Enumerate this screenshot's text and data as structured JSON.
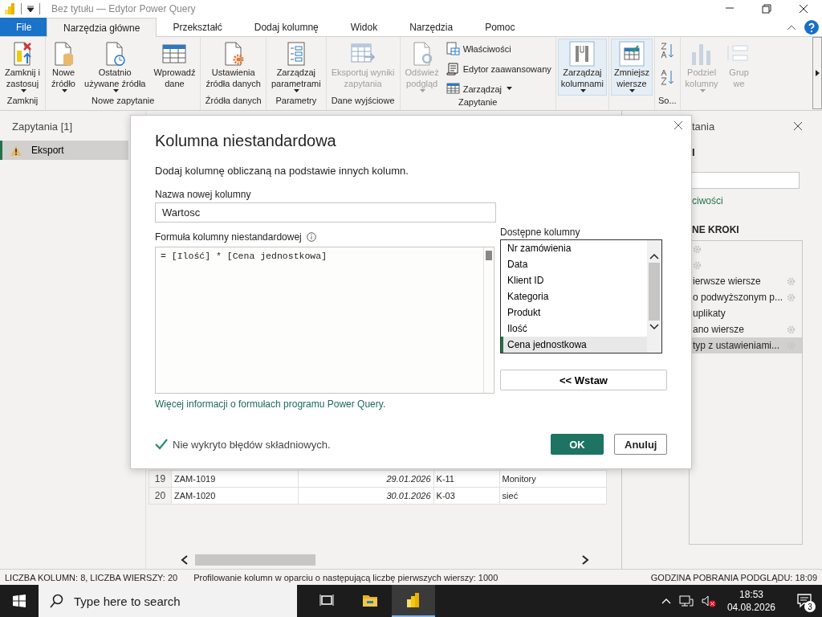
{
  "window": {
    "title": "Bez tytułu — Edytor Power Query"
  },
  "tabs": [
    {
      "label": "File",
      "kind": "file",
      "selected": false
    },
    {
      "label": "Narzędzia główne",
      "kind": "tab",
      "selected": true
    },
    {
      "label": "Przekształć",
      "kind": "tab",
      "selected": false
    },
    {
      "label": "Dodaj kolumnę",
      "kind": "tab",
      "selected": false
    },
    {
      "label": "Widok",
      "kind": "tab",
      "selected": false
    },
    {
      "label": "Narzędzia",
      "kind": "tab",
      "selected": false
    },
    {
      "label": "Pomoc",
      "kind": "tab",
      "selected": false
    }
  ],
  "ribbon": {
    "groups": [
      {
        "label": "Zamknij",
        "buttons": [
          {
            "label": "Zamknij i\nzastosuj",
            "kind": "large",
            "dropdown": true,
            "disabled": false,
            "highlighted": false
          }
        ]
      },
      {
        "label": "Nowe zapytanie",
        "buttons": [
          {
            "label": "Nowe\nźródło",
            "kind": "large",
            "dropdown": true,
            "disabled": false,
            "highlighted": false
          },
          {
            "label": "Ostatnio\nużywane źródła",
            "kind": "large",
            "dropdown": true,
            "disabled": false,
            "highlighted": false
          },
          {
            "label": "Wprowadź\ndane",
            "kind": "large",
            "dropdown": false,
            "disabled": false,
            "highlighted": false
          }
        ]
      },
      {
        "label": "Źródła danych",
        "buttons": [
          {
            "label": "Ustawienia\nźródła danych",
            "kind": "large",
            "dropdown": false,
            "disabled": false,
            "highlighted": false
          }
        ]
      },
      {
        "label": "Parametry",
        "buttons": [
          {
            "label": "Zarządzaj\nparametrami",
            "kind": "large",
            "dropdown": true,
            "disabled": false,
            "highlighted": false
          }
        ]
      },
      {
        "label": "Dane wyjściowe",
        "buttons": [
          {
            "label": "Eksportuj wyniki\nzapytania",
            "kind": "large",
            "dropdown": false,
            "disabled": true,
            "highlighted": false
          }
        ]
      },
      {
        "label": "Zapytanie",
        "buttons": [
          {
            "label": "Odśwież\npodgląd",
            "kind": "large",
            "dropdown": true,
            "disabled": true,
            "highlighted": false
          },
          {
            "label": "Właściwości",
            "kind": "small",
            "dropdown": false,
            "disabled": false,
            "highlighted": false
          },
          {
            "label": "Edytor zaawansowany",
            "kind": "small",
            "dropdown": false,
            "disabled": false,
            "highlighted": false
          },
          {
            "label": "Zarządzaj",
            "kind": "small",
            "dropdown": true,
            "disabled": false,
            "highlighted": false
          }
        ]
      },
      {
        "buttons": [
          {
            "label": "Zarządzaj\nkolumnami",
            "kind": "large",
            "dropdown": true,
            "disabled": false,
            "highlighted": true
          }
        ]
      },
      {
        "buttons": [
          {
            "label": "Zmniejsz\nwiersze",
            "kind": "large",
            "dropdown": true,
            "disabled": false,
            "highlighted": true
          }
        ]
      },
      {
        "label": "So...",
        "buttons": [
          {
            "kind": "icon",
            "dropdown": false,
            "disabled": false,
            "highlighted": false
          },
          {
            "kind": "icon",
            "dropdown": false,
            "disabled": false,
            "highlighted": false
          }
        ]
      },
      {
        "buttons": [
          {
            "label": "Podziel\nkolumny",
            "kind": "large",
            "dropdown": true,
            "disabled": true,
            "highlighted": false
          },
          {
            "label": "Grup\nwe",
            "kind": "large",
            "dropdown": false,
            "disabled": true,
            "highlighted": false
          }
        ]
      }
    ]
  },
  "queries": {
    "title": "Zapytania [1]",
    "items": [
      {
        "label": "Eksport",
        "warning": true,
        "selected": true
      }
    ]
  },
  "grid": {
    "columns": [
      {
        "kind": "text"
      },
      {
        "kind": "date"
      },
      {
        "kind": "text"
      },
      {
        "kind": "text"
      }
    ],
    "rows": [
      {
        "index": "19",
        "cells": [
          "ZAM-1019",
          "29.01.2026",
          "K-11",
          "Monitory"
        ]
      },
      {
        "index": "20",
        "cells": [
          "ZAM-1020",
          "30.01.2026",
          "K-03",
          "sieć"
        ]
      }
    ]
  },
  "settings_pane": {
    "title": "tania",
    "section": "I",
    "link": "ciwości",
    "steps_header": "NE KROKI",
    "steps": [
      {
        "gear": true,
        "selected": false
      },
      {
        "gear": true,
        "selected": false
      },
      {
        "label": "ierwsze wiersze",
        "gear": true,
        "selected": false
      },
      {
        "label": "o podwyższonym p...",
        "gear": true,
        "selected": false
      },
      {
        "label": "uplikaty",
        "gear": false,
        "selected": false
      },
      {
        "label": "ano wiersze",
        "gear": true,
        "selected": false
      },
      {
        "label": "typ z ustawieniami...",
        "gear": true,
        "selected": true
      }
    ]
  },
  "dialog": {
    "title": "Kolumna niestandardowa",
    "description": "Dodaj kolumnę obliczaną na podstawie innych kolumn.",
    "name_label": "Nazwa nowej kolumny",
    "name_value": "Wartosc",
    "formula_label": "Formuła kolumny niestandardowej",
    "formula": "= [Ilość] * [Cena jednostkowa]",
    "columns_label": "Dostępne kolumny",
    "columns": [
      {
        "label": "Nr zamówienia",
        "selected": false
      },
      {
        "label": "Data",
        "selected": false
      },
      {
        "label": "Klient ID",
        "selected": false
      },
      {
        "label": "Kategoria",
        "selected": false
      },
      {
        "label": "Produkt",
        "selected": false
      },
      {
        "label": "Ilość",
        "selected": false
      },
      {
        "label": "Cena jednostkowa",
        "selected": true
      }
    ],
    "insert_button": "<< Wstaw",
    "help_link": "Więcej informacji o formułach programu Power Query.",
    "status": {
      "text": "Nie wykryto błędów składniowych.",
      "ok": true
    },
    "buttons": [
      {
        "label": "OK",
        "kind": "primary"
      },
      {
        "label": "Anuluj",
        "kind": "secondary"
      }
    ]
  },
  "status_bar": {
    "counts": "LICZBA KOLUMN: 8, LICZBA WIERSZY: 20",
    "profiling": "Profilowanie kolumn w oparciu o następującą liczbę pierwszych wierszy: 1000",
    "preview_time": "GODZINA POBRANIA PODGLĄDU: 18:09"
  },
  "taskbar": {
    "search_placeholder": "Type here to search",
    "apps": [
      {
        "kind": "taskview",
        "active": false
      },
      {
        "kind": "explorer",
        "active": false
      },
      {
        "kind": "powerbi",
        "active": true
      }
    ],
    "time": "18:53",
    "date": "04.08.2026",
    "notifications": "3"
  }
}
